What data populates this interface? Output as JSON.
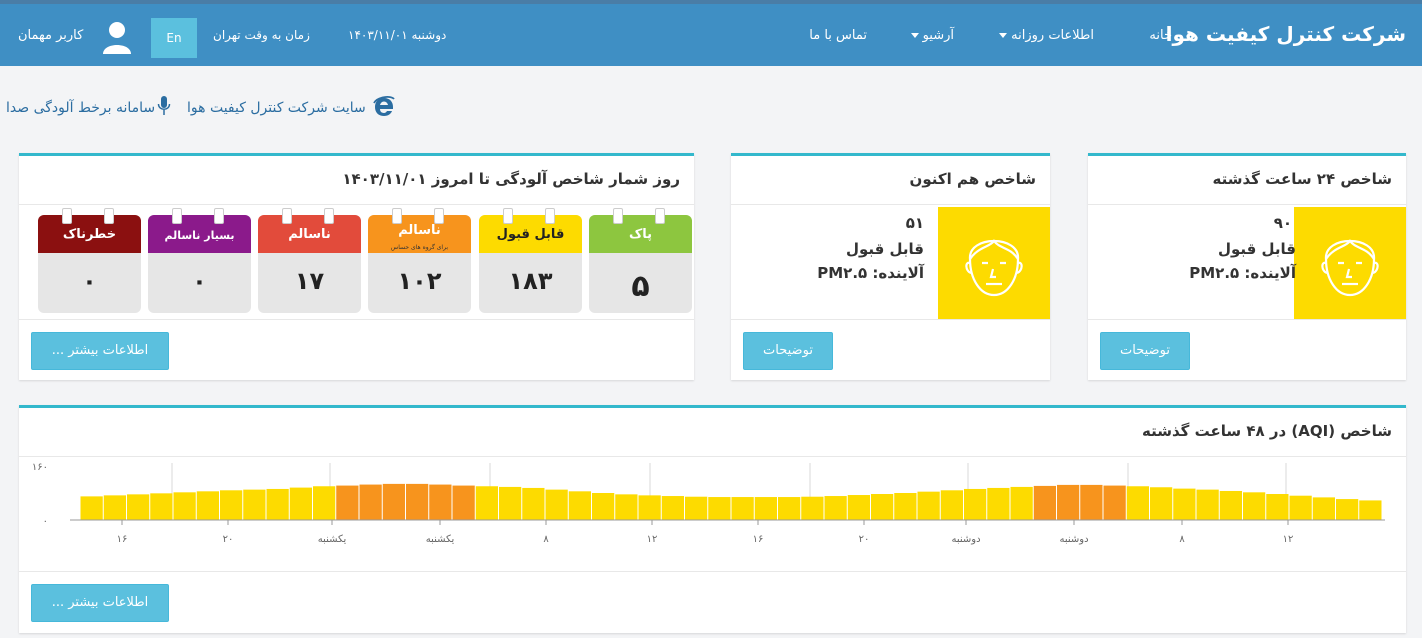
{
  "header": {
    "brand": "شرکت کنترل کیفیت هوا",
    "nav": {
      "home": "خانه",
      "daily": "اطلاعات روزانه",
      "archive": "آرشیو",
      "contact": "تماس با ما"
    },
    "date": "دوشنبه ۱۴۰۳/۱۱/۰۱",
    "timezone": "زمان به وقت تهران",
    "lang": "En",
    "user": "کاربر مهمان"
  },
  "links": {
    "site": "سایت شرکت کنترل کیفیت هوا",
    "noise": "سامانه برخط آلودگی صدا"
  },
  "past24": {
    "title": "شاخص ۲۴ ساعت گذشته",
    "value": "۹۰",
    "status": "قابل قبول",
    "pollutant": "آلاینده: PM۲.۵",
    "button": "توضیحات"
  },
  "current": {
    "title": "شاخص هم اکنون",
    "value": "۵۱",
    "status": "قابل قبول",
    "pollutant": "آلاینده: PM۲.۵",
    "button": "توضیحات"
  },
  "counter": {
    "title": "روز شمار شاخص آلودگی تا امروز ۱۴۰۳/۱۱/۰۱",
    "button": "اطلاعات بیشتر ...",
    "tiles": [
      {
        "label": "پاک",
        "sub": "",
        "count": "۵",
        "color": "#8dc63f"
      },
      {
        "label": "قابل قبول",
        "sub": "",
        "count": "۱۸۳",
        "color": "#fddb00"
      },
      {
        "label": "ناسالم",
        "sub": "برای گروه های حساس",
        "count": "۱۰۲",
        "color": "#f7941d"
      },
      {
        "label": "ناسالم",
        "sub": "",
        "count": "۱۷",
        "color": "#e24b3b"
      },
      {
        "label": "بسیار ناسالم",
        "sub": "",
        "count": "۰",
        "color": "#8b1a8b"
      },
      {
        "label": "خطرناک",
        "sub": "",
        "count": "۰",
        "color": "#8b1010"
      }
    ]
  },
  "aqi48": {
    "title": "شاخص (AQI) در ۴۸ ساعت گذشته",
    "button": "اطلاعات بیشتر ..."
  },
  "chart_data": {
    "type": "bar",
    "ylim": [
      0,
      160
    ],
    "ytick_labels": [
      "۰",
      "۱۶۰"
    ],
    "xtick_labels": [
      "۱۶",
      "۲۰",
      "یکشنبه",
      "یکشنبه",
      "۸",
      "۱۲",
      "۱۶",
      "۲۰",
      "دوشنبه",
      "دوشنبه",
      "۸",
      "۱۲"
    ],
    "values": [
      70,
      73,
      76,
      79,
      82,
      85,
      88,
      90,
      92,
      96,
      100,
      102,
      105,
      107,
      107,
      105,
      102,
      100,
      98,
      95,
      90,
      85,
      80,
      76,
      73,
      71,
      69,
      68,
      68,
      68,
      68,
      69,
      71,
      74,
      77,
      80,
      84,
      88,
      92,
      95,
      98,
      101,
      104,
      104,
      102,
      100,
      97,
      93,
      90,
      86,
      82,
      77,
      72,
      67,
      62,
      58
    ],
    "colors": {
      "moderate": "#fddb00",
      "sensitive": "#f7941d"
    },
    "threshold": 100
  }
}
